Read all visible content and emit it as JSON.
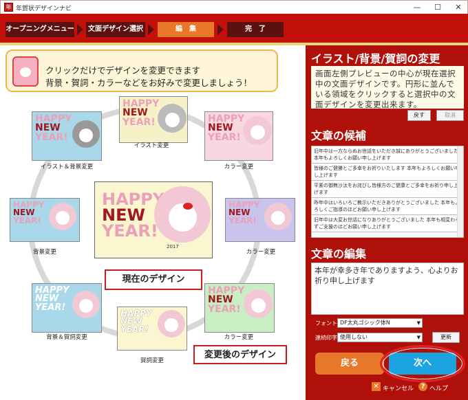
{
  "window": {
    "title": "年賀状デザインナビ",
    "min": "—",
    "max": "☐",
    "close": "✕"
  },
  "steps": [
    "オープニングメニュー",
    "文面デザイン選択",
    "編　集",
    "完　了"
  ],
  "tip": {
    "line1": "クリックだけでデザインを変更できます",
    "line2": "背景・賀詞・カラーなどをお好みで変更しましょう！"
  },
  "cards": {
    "top": "イラスト変更",
    "topleft": "イラスト＆背景変更",
    "topright": "カラー変更",
    "left": "背景変更",
    "right": "カラー変更",
    "bottomleft": "背景＆賀詞変更",
    "bottom": "賀詞変更",
    "bottomright": "カラー変更",
    "year": "2017",
    "hn": [
      "HAPPY",
      "NEW",
      "YEAR!"
    ]
  },
  "labels": {
    "current": "現在のデザイン",
    "after": "変更後のデザイン"
  },
  "right": {
    "h1": "イラスト/背景/賀詞の変更",
    "desc": "画面左側プレビューの中心が現在選択中の文面デザインです。円形に並んでいる領域をクリックすると選択中の文面デザインを変更出来ます。",
    "undo": "戻す",
    "cancel": "取消",
    "h2": "文章の候補",
    "candidates": [
      "旧年中は一方ならぬお世話をいただき誠にありがとうございました 本年もよろしくお願い申し上げます",
      "皆様のご健勝とご多幸をお祈りいたします 本年もよろしくお願い申し上げます",
      "平素の御無沙汰をお詫びし皆様方のご健康とご多幸をお祈り申し上げます",
      "昨年中はいろいろご教示いただきありがとうございました 本年もよろしくご指導のほどお願い申し上げます",
      "旧年中は大変お世話になりありがとうございました 本年も相変わらずご支援のほどお願い申し上げます"
    ],
    "h3": "文章の編集",
    "edit": "本年が幸多き年でありますよう、心よりお祈り申し上げます",
    "font_label": "フォント",
    "font_value": "DF太丸ゴシック体N",
    "cont_label": "連続印字",
    "cont_value": "使用しない",
    "update": "更新",
    "back": "戻る",
    "next": "次へ",
    "cancel_app": "キャンセル",
    "help": "ヘルプ"
  }
}
